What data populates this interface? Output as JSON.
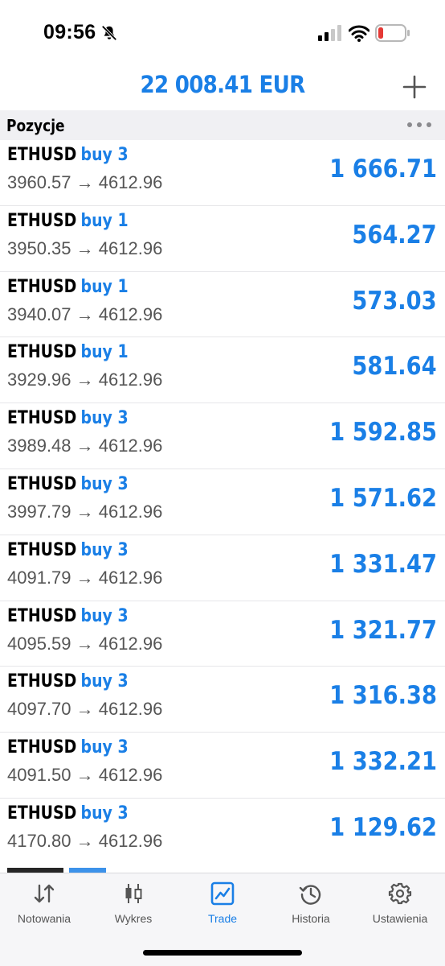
{
  "status": {
    "time": "09:56",
    "icons": [
      "bell-slash-icon",
      "cellular-signal-icon",
      "wifi-icon",
      "battery-low-icon"
    ],
    "battery_color": "#e53935"
  },
  "header": {
    "balance": "22 008.41 EUR",
    "add_icon": "plus-icon"
  },
  "section": {
    "title": "Pozycje",
    "more_icon": "ellipsis-icon"
  },
  "positions": [
    {
      "symbol": "ETHUSD",
      "side": "buy 3",
      "open": "3960.57",
      "current": "4612.96",
      "profit": "1 666.71"
    },
    {
      "symbol": "ETHUSD",
      "side": "buy 1",
      "open": "3950.35",
      "current": "4612.96",
      "profit": "564.27"
    },
    {
      "symbol": "ETHUSD",
      "side": "buy 1",
      "open": "3940.07",
      "current": "4612.96",
      "profit": "573.03"
    },
    {
      "symbol": "ETHUSD",
      "side": "buy 1",
      "open": "3929.96",
      "current": "4612.96",
      "profit": "581.64"
    },
    {
      "symbol": "ETHUSD",
      "side": "buy 3",
      "open": "3989.48",
      "current": "4612.96",
      "profit": "1 592.85"
    },
    {
      "symbol": "ETHUSD",
      "side": "buy 3",
      "open": "3997.79",
      "current": "4612.96",
      "profit": "1 571.62"
    },
    {
      "symbol": "ETHUSD",
      "side": "buy 3",
      "open": "4091.79",
      "current": "4612.96",
      "profit": "1 331.47"
    },
    {
      "symbol": "ETHUSD",
      "side": "buy 3",
      "open": "4095.59",
      "current": "4612.96",
      "profit": "1 321.77"
    },
    {
      "symbol": "ETHUSD",
      "side": "buy 3",
      "open": "4097.70",
      "current": "4612.96",
      "profit": "1 316.38"
    },
    {
      "symbol": "ETHUSD",
      "side": "buy 3",
      "open": "4091.50",
      "current": "4612.96",
      "profit": "1 332.21"
    },
    {
      "symbol": "ETHUSD",
      "side": "buy 3",
      "open": "4170.80",
      "current": "4612.96",
      "profit": "1 129.62"
    }
  ],
  "arrow": "→",
  "tabs": [
    {
      "label": "Notowania",
      "icon": "quotes-arrows-icon"
    },
    {
      "label": "Wykres",
      "icon": "candlestick-chart-icon"
    },
    {
      "label": "Trade",
      "icon": "trade-chart-icon",
      "active": true
    },
    {
      "label": "Historia",
      "icon": "history-clock-icon"
    },
    {
      "label": "Ustawienia",
      "icon": "gear-icon"
    }
  ],
  "colors": {
    "accent": "#1a7fe6",
    "muted_text": "#555555",
    "section_bg": "#f0f0f3"
  }
}
